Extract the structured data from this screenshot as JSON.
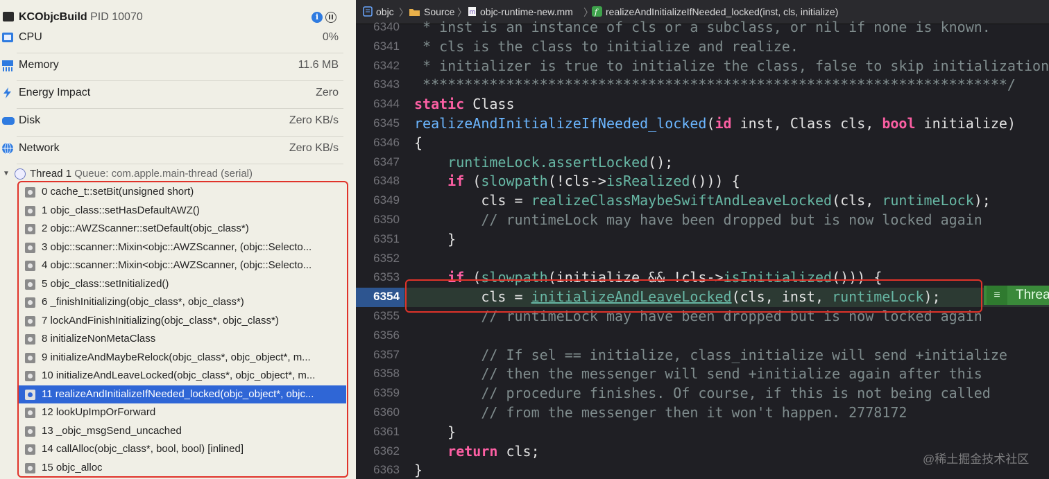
{
  "process": {
    "name": "KCObjcBuild",
    "pid": "PID 10070"
  },
  "gauges": [
    {
      "label": "CPU",
      "value": "0%",
      "icon": "cpu-icon"
    },
    {
      "label": "Memory",
      "value": "11.6 MB",
      "icon": "memory-icon"
    },
    {
      "label": "Energy Impact",
      "value": "Zero",
      "icon": "energy-icon"
    },
    {
      "label": "Disk",
      "value": "Zero KB/s",
      "icon": "disk-icon"
    },
    {
      "label": "Network",
      "value": "Zero KB/s",
      "icon": "network-icon"
    }
  ],
  "thread": {
    "name": "Thread 1",
    "queue": "Queue: com.apple.main-thread (serial)"
  },
  "frames": [
    "0 cache_t::setBit(unsigned short)",
    "1 objc_class::setHasDefaultAWZ()",
    "2 objc::AWZScanner::setDefault(objc_class*)",
    "3 objc::scanner::Mixin<objc::AWZScanner, (objc::Selecto...",
    "4 objc::scanner::Mixin<objc::AWZScanner, (objc::Selecto...",
    "5 objc_class::setInitialized()",
    "6 _finishInitializing(objc_class*, objc_class*)",
    "7 lockAndFinishInitializing(objc_class*, objc_class*)",
    "8 initializeNonMetaClass",
    "9 initializeAndMaybeRelock(objc_class*, objc_object*, m...",
    "10 initializeAndLeaveLocked(objc_class*, objc_object*, m...",
    "11 realizeAndInitializeIfNeeded_locked(objc_object*, objc...",
    "12 lookUpImpOrForward",
    "13 _objc_msgSend_uncached",
    "14 callAlloc(objc_class*, bool, bool) [inlined]",
    "15 objc_alloc"
  ],
  "selected_frame_index": 11,
  "jumpbar": {
    "project": "objc",
    "folder": "Source",
    "file": "objc-runtime-new.mm",
    "symbol": "realizeAndInitializeIfNeeded_locked(inst, cls, initialize)"
  },
  "code_lines": [
    {
      "n": "6340",
      "text": " * inst is an instance of cls or a subclass, or nil if none is known."
    },
    {
      "n": "6341",
      "text": " * cls is the class to initialize and realize."
    },
    {
      "n": "6342",
      "text": " * initializer is true to initialize the class, false to skip initialization."
    },
    {
      "n": "6343",
      "text": " **********************************************************************/"
    },
    {
      "n": "6344",
      "text": "static Class"
    },
    {
      "n": "6345",
      "text": "realizeAndInitializeIfNeeded_locked(id inst, Class cls, bool initialize)"
    },
    {
      "n": "6346",
      "text": "{"
    },
    {
      "n": "6347",
      "text": "    runtimeLock.assertLocked();"
    },
    {
      "n": "6348",
      "text": "    if (slowpath(!cls->isRealized())) {"
    },
    {
      "n": "6349",
      "text": "        cls = realizeClassMaybeSwiftAndLeaveLocked(cls, runtimeLock);"
    },
    {
      "n": "6350",
      "text": "        // runtimeLock may have been dropped but is now locked again"
    },
    {
      "n": "6351",
      "text": "    }"
    },
    {
      "n": "6352",
      "text": ""
    },
    {
      "n": "6353",
      "text": "    if (slowpath(initialize && !cls->isInitialized())) {"
    },
    {
      "n": "6354",
      "text": "        cls = initializeAndLeaveLocked(cls, inst, runtimeLock);"
    },
    {
      "n": "6355",
      "text": "        // runtimeLock may have been dropped but is now locked again"
    },
    {
      "n": "6356",
      "text": ""
    },
    {
      "n": "6357",
      "text": "        // If sel == initialize, class_initialize will send +initialize"
    },
    {
      "n": "6358",
      "text": "        // then the messenger will send +initialize again after this"
    },
    {
      "n": "6359",
      "text": "        // procedure finishes. Of course, if this is not being called"
    },
    {
      "n": "6360",
      "text": "        // from the messenger then it won't happen. 2778172"
    },
    {
      "n": "6361",
      "text": "    }"
    },
    {
      "n": "6362",
      "text": "    return cls;"
    },
    {
      "n": "6363",
      "text": "}"
    }
  ],
  "current_line": "6354",
  "thread_badge": "Threa",
  "watermark": "@稀土掘金技术社区",
  "colors": {
    "keyword": "#fc5fa3",
    "function": "#67b7a4",
    "declaration": "#6bb6ff",
    "comment": "#7f8c8d",
    "selection": "#2f66d6",
    "highlight_box": "#e0332a",
    "thread_badge": "#3a8a3a"
  }
}
